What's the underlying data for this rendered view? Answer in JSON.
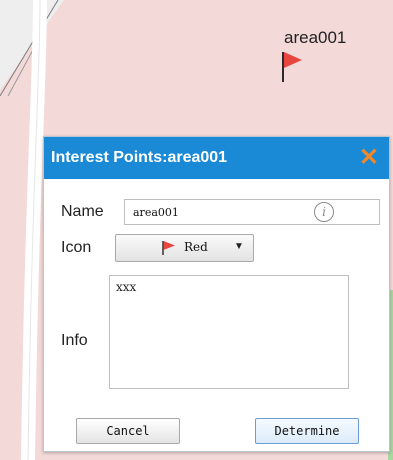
{
  "map": {
    "marker": {
      "label": "area001",
      "flag_color": "#e8463f"
    }
  },
  "dialog": {
    "title": "Interest Points:area001",
    "close_symbol": "✕",
    "name_label": "Name",
    "name_value": "area001",
    "info_icon_symbol": "i",
    "icon_label": "Icon",
    "icon_select_value": "Red",
    "info_label": "Info",
    "info_value": "xxx",
    "cancel_label": "Cancel",
    "determine_label": "Determine"
  },
  "colors": {
    "header_bg": "#1a8ad6",
    "close_icon": "#f0882a",
    "map_bg": "#f3d9d8",
    "road": "#ffffff"
  },
  "icons": [
    "flag-icon",
    "close-icon",
    "info-icon",
    "chevron-down-icon"
  ]
}
